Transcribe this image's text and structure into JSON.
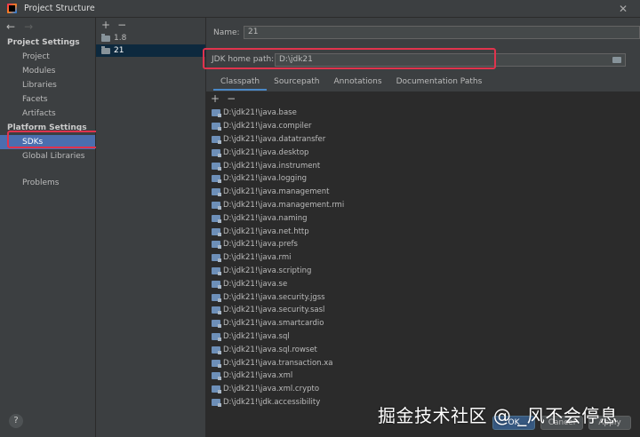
{
  "window": {
    "title": "Project Structure",
    "close_glyph": "✕"
  },
  "nav": {
    "back": "←",
    "forward": "→"
  },
  "sidebar": {
    "project_settings_heading": "Project Settings",
    "project_items": [
      "Project",
      "Modules",
      "Libraries",
      "Facets",
      "Artifacts"
    ],
    "platform_settings_heading": "Platform Settings",
    "platform_items": [
      "SDKs",
      "Global Libraries"
    ],
    "other_items": [
      "Problems"
    ],
    "selected": "SDKs",
    "help": "?"
  },
  "sdk_panel": {
    "add": "+",
    "remove": "−",
    "items": [
      {
        "label": "1.8",
        "selected": false
      },
      {
        "label": "21",
        "selected": true
      }
    ]
  },
  "main": {
    "name_label": "Name:",
    "name_value": "21",
    "jdk_label": "JDK home path:",
    "jdk_value": "D:\\jdk21",
    "tabs": [
      "Classpath",
      "Sourcepath",
      "Annotations",
      "Documentation Paths"
    ],
    "active_tab": "Classpath",
    "cp_add": "+",
    "cp_remove": "−",
    "classpath": [
      "D:\\jdk21!\\java.base",
      "D:\\jdk21!\\java.compiler",
      "D:\\jdk21!\\java.datatransfer",
      "D:\\jdk21!\\java.desktop",
      "D:\\jdk21!\\java.instrument",
      "D:\\jdk21!\\java.logging",
      "D:\\jdk21!\\java.management",
      "D:\\jdk21!\\java.management.rmi",
      "D:\\jdk21!\\java.naming",
      "D:\\jdk21!\\java.net.http",
      "D:\\jdk21!\\java.prefs",
      "D:\\jdk21!\\java.rmi",
      "D:\\jdk21!\\java.scripting",
      "D:\\jdk21!\\java.se",
      "D:\\jdk21!\\java.security.jgss",
      "D:\\jdk21!\\java.security.sasl",
      "D:\\jdk21!\\java.smartcardio",
      "D:\\jdk21!\\java.sql",
      "D:\\jdk21!\\java.sql.rowset",
      "D:\\jdk21!\\java.transaction.xa",
      "D:\\jdk21!\\java.xml",
      "D:\\jdk21!\\java.xml.crypto",
      "D:\\jdk21!\\jdk.accessibility"
    ]
  },
  "footer": {
    "ok": "OK",
    "cancel": "Cancel",
    "apply": "Apply"
  },
  "watermark": "掘金技术社区 @ _风不会停息",
  "colors": {
    "highlight": "#e0334d",
    "selection": "#4b6eaf",
    "tab_underline": "#4a88c7"
  }
}
